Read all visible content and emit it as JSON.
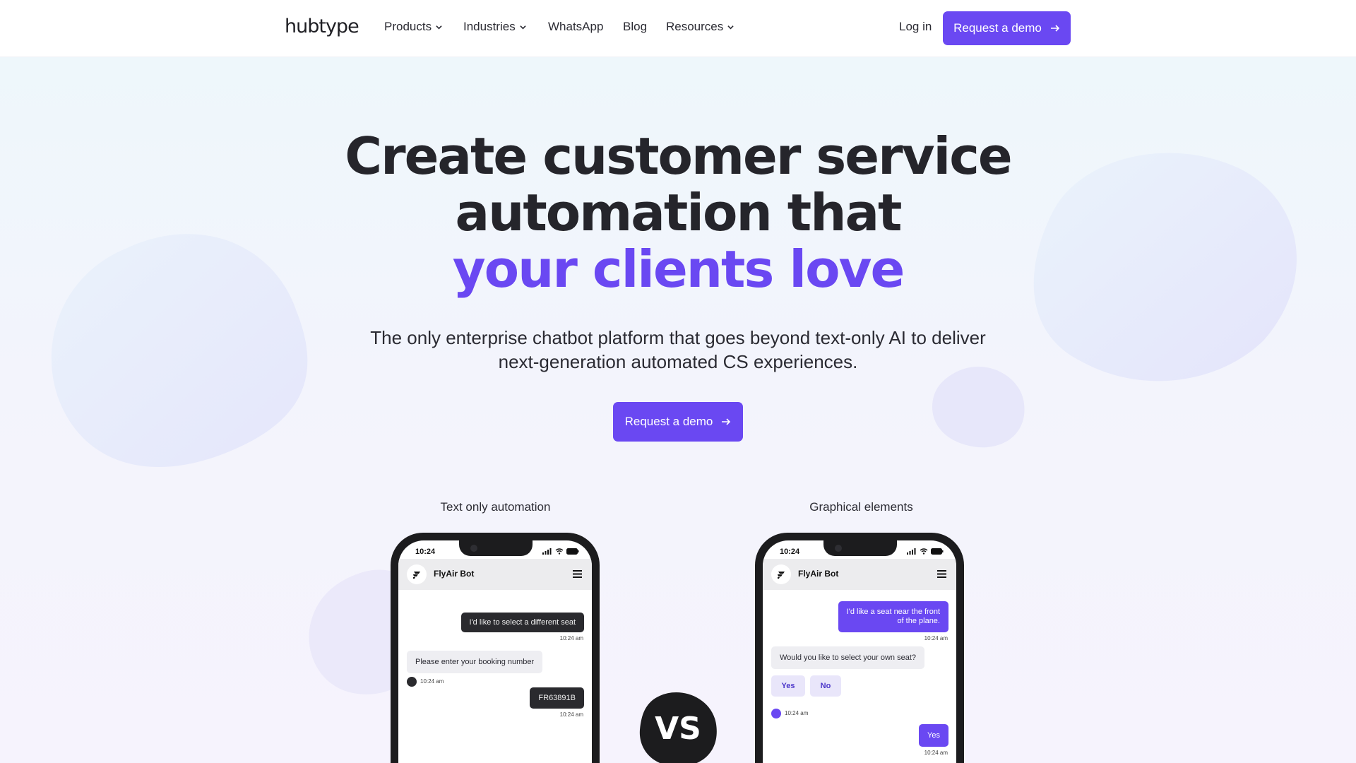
{
  "nav": {
    "logo": "hubtype",
    "items": [
      {
        "label": "Products",
        "dropdown": true
      },
      {
        "label": "Industries",
        "dropdown": true
      },
      {
        "label": "WhatsApp",
        "dropdown": false
      },
      {
        "label": "Blog",
        "dropdown": false
      },
      {
        "label": "Resources",
        "dropdown": true
      }
    ],
    "login": "Log in",
    "cta": "Request a demo"
  },
  "hero": {
    "title_line1": "Create customer service",
    "title_line2": "automation that",
    "title_highlight": "your clients love",
    "subtitle_line1": "The only enterprise chatbot platform that goes beyond text-only AI to deliver",
    "subtitle_line2": "next-generation automated CS experiences.",
    "cta": "Request a demo"
  },
  "comparison": {
    "left_caption": "Text only automation",
    "right_caption": "Graphical elements",
    "vs": "VS",
    "left_phone": {
      "time": "10:24",
      "bot_name": "FlyAir Bot",
      "messages": [
        {
          "text": "I'd like to select a different seat",
          "time": "10:24 am"
        },
        {
          "text": "Please enter your booking number",
          "time": "10:24 am"
        },
        {
          "text": "FR63891B",
          "time": "10:24 am"
        }
      ]
    },
    "right_phone": {
      "time": "10:24",
      "bot_name": "FlyAir Bot",
      "msg1_line1": "I'd like a seat near the front",
      "msg1_line2": "of the plane.",
      "msg1_time": "10:24 am",
      "msg2": "Would you like to select your own seat?",
      "quick_yes": "Yes",
      "quick_no": "No",
      "msg2_time": "10:24 am",
      "msg3": "Yes",
      "msg3_time": "10:24 am"
    }
  },
  "colors": {
    "accent": "#6a48f2",
    "text_dark": "#25252b"
  }
}
